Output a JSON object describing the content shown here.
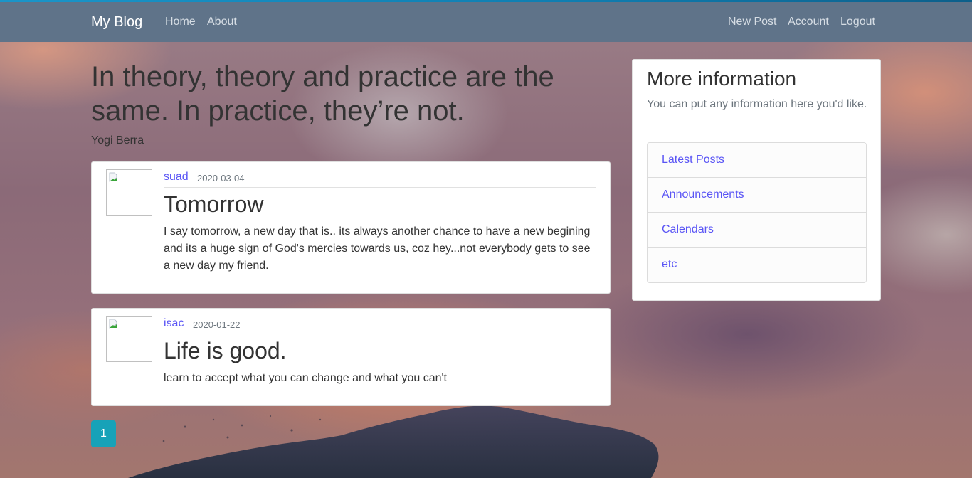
{
  "navbar": {
    "brand": "My Blog",
    "left_links": [
      "Home",
      "About"
    ],
    "right_links": [
      "New Post",
      "Account",
      "Logout"
    ],
    "background_color": "#5f7389"
  },
  "quote": {
    "text": "In theory, theory and practice are the same. In practice, they’re not.",
    "author": "Yogi Berra"
  },
  "posts": [
    {
      "author": "suad",
      "date": "2020-03-04",
      "title": "Tomorrow",
      "content": "I say tomorrow, a new day that is.. its always another chance to have a new begining and its a huge sign of God's mercies towards us, coz hey...not everybody gets to see a new day my friend.",
      "avatar_icon": "broken-image-icon"
    },
    {
      "author": "isac",
      "date": "2020-01-22",
      "title": "Life is good.",
      "content": "learn to accept what you can change and what you can't",
      "avatar_icon": "broken-image-icon"
    }
  ],
  "pagination": {
    "pages": [
      "1"
    ],
    "current": "1",
    "active_color": "#17a2b8"
  },
  "sidebar": {
    "title": "More information",
    "description": "You can put any information here you'd like.",
    "links": [
      "Latest Posts",
      "Announcements",
      "Calendars",
      "etc"
    ],
    "link_color": "#5a55f5"
  }
}
